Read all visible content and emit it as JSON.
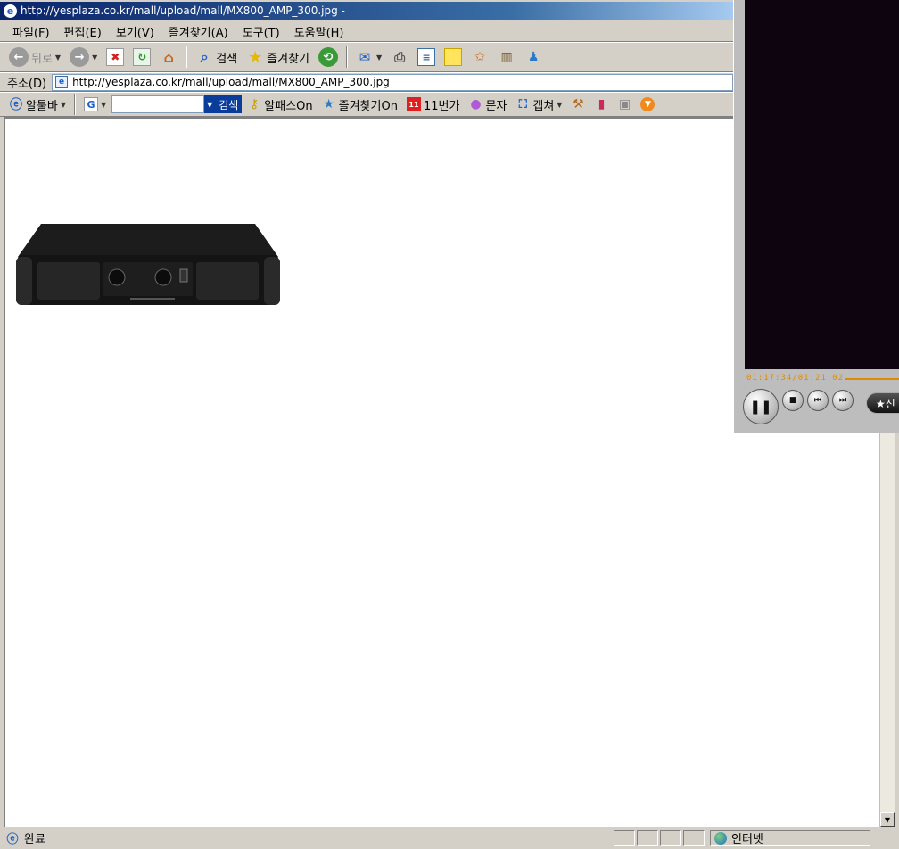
{
  "window": {
    "title": "http://yesplaza.co.kr/mall/upload/mall/MX800_AMP_300.jpg -"
  },
  "menubar": {
    "items": [
      "파일(F)",
      "편집(E)",
      "보기(V)",
      "즐겨찾기(A)",
      "도구(T)",
      "도움말(H)"
    ]
  },
  "toolbar": {
    "back_label": "뒤로",
    "search_label": "검색",
    "favorites_label": "즐겨찾기"
  },
  "address": {
    "label": "주소(D)",
    "url": "http://yesplaza.co.kr/mall/upload/mall/MX800_AMP_300.jpg"
  },
  "linksbar": {
    "altoolbar_label": "알툴바",
    "google_input_value": "",
    "search_button": "검색",
    "alpass_label": "알패스On",
    "favorites_on_label": "즐겨찾기On",
    "eleven_label": "11번가",
    "sms_label": "문자",
    "capture_label": "캡쳐"
  },
  "status": {
    "text": "완료",
    "zone": "인터넷"
  },
  "player": {
    "time": "01:17:34/01:21:02",
    "extra_button": "★신"
  },
  "image": {
    "alt": "MX800_AMP_300.jpg"
  }
}
